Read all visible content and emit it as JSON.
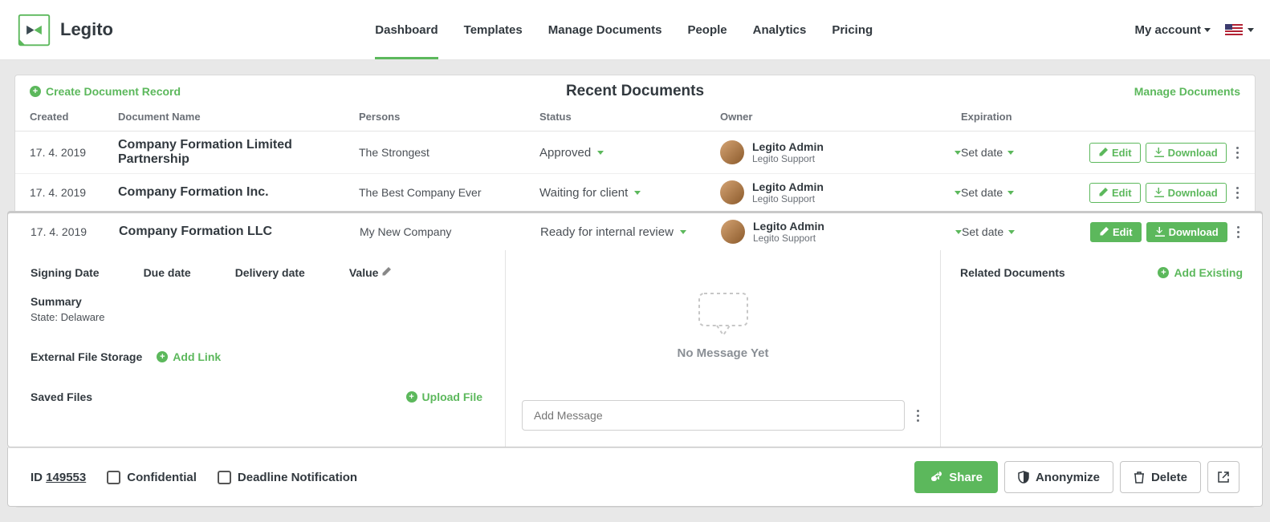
{
  "brand": {
    "name": "Legito"
  },
  "nav": {
    "dashboard": "Dashboard",
    "templates": "Templates",
    "manage_documents": "Manage Documents",
    "people": "People",
    "analytics": "Analytics",
    "pricing": "Pricing"
  },
  "account": {
    "label": "My account"
  },
  "panel": {
    "create_label": "Create Document Record",
    "title": "Recent Documents",
    "manage_link": "Manage Documents"
  },
  "columns": {
    "created": "Created",
    "document_name": "Document Name",
    "persons": "Persons",
    "status": "Status",
    "owner": "Owner",
    "expiration": "Expiration"
  },
  "rows": [
    {
      "created": "17. 4. 2019",
      "name": "Company Formation Limited Partnership",
      "persons": "The Strongest",
      "status": "Approved",
      "owner_name": "Legito Admin",
      "owner_sub": "Legito Support",
      "expiration": "Set date"
    },
    {
      "created": "17. 4. 2019",
      "name": "Company Formation Inc.",
      "persons": "The Best Company Ever",
      "status": "Waiting for client",
      "owner_name": "Legito Admin",
      "owner_sub": "Legito Support",
      "expiration": "Set date"
    },
    {
      "created": "17. 4. 2019",
      "name": "Company Formation LLC",
      "persons": "My New Company",
      "status": "Ready for internal review",
      "owner_name": "Legito Admin",
      "owner_sub": "Legito Support",
      "expiration": "Set date"
    }
  ],
  "buttons": {
    "edit": "Edit",
    "download": "Download"
  },
  "detail": {
    "signing_date": "Signing Date",
    "due_date": "Due date",
    "delivery_date": "Delivery date",
    "value": "Value",
    "summary_label": "Summary",
    "summary_text": "State: Delaware",
    "external_storage": "External File Storage",
    "add_link": "Add Link",
    "saved_files": "Saved Files",
    "upload_file": "Upload File"
  },
  "messages": {
    "empty": "No Message Yet",
    "placeholder": "Add Message"
  },
  "related": {
    "label": "Related Documents",
    "add_existing": "Add Existing"
  },
  "footer": {
    "id_label": "ID",
    "id_value": "149553",
    "confidential": "Confidential",
    "deadline": "Deadline Notification",
    "share": "Share",
    "anonymize": "Anonymize",
    "delete": "Delete"
  }
}
